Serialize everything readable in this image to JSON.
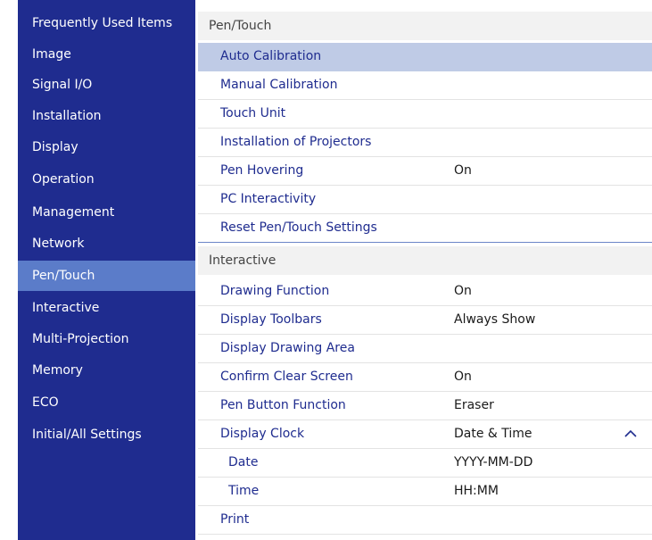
{
  "sidebar": {
    "items": [
      {
        "label": "Frequently Used Items"
      },
      {
        "label": "Image"
      },
      {
        "label": "Signal I/O"
      },
      {
        "label": "Installation"
      },
      {
        "label": "Display"
      },
      {
        "label": "Operation"
      },
      {
        "label": "Management"
      },
      {
        "label": "Network"
      },
      {
        "label": "Pen/Touch"
      },
      {
        "label": "Interactive"
      },
      {
        "label": "Multi-Projection"
      },
      {
        "label": "Memory"
      },
      {
        "label": "ECO"
      },
      {
        "label": "Initial/All Settings"
      }
    ],
    "selected_index": 8
  },
  "main": {
    "pen_touch": {
      "header": "Pen/Touch",
      "rows": [
        {
          "label": "Auto Calibration",
          "value": ""
        },
        {
          "label": "Manual Calibration",
          "value": ""
        },
        {
          "label": "Touch Unit",
          "value": ""
        },
        {
          "label": "Installation of Projectors",
          "value": ""
        },
        {
          "label": "Pen Hovering",
          "value": "On"
        },
        {
          "label": "PC Interactivity",
          "value": ""
        },
        {
          "label": "Reset Pen/Touch Settings",
          "value": ""
        }
      ]
    },
    "interactive": {
      "header": "Interactive",
      "rows": [
        {
          "label": "Drawing Function",
          "value": "On"
        },
        {
          "label": "Display Toolbars",
          "value": "Always Show"
        },
        {
          "label": "Display Drawing Area",
          "value": ""
        },
        {
          "label": "Confirm Clear Screen",
          "value": "On"
        },
        {
          "label": "Pen Button Function",
          "value": "Eraser"
        },
        {
          "label": "Display Clock",
          "value": "Date & Time",
          "icon": "chevron-up-icon"
        },
        {
          "label": "Date",
          "value": "YYYY-MM-DD"
        },
        {
          "label": "Time",
          "value": "HH:MM"
        },
        {
          "label": "Print",
          "value": ""
        }
      ]
    }
  },
  "colors": {
    "sidebar_bg": "#1f2c8f",
    "sidebar_selected": "#5b7cc9",
    "row_highlight": "#bfcbe6",
    "item_text": "#1f2c8f"
  }
}
